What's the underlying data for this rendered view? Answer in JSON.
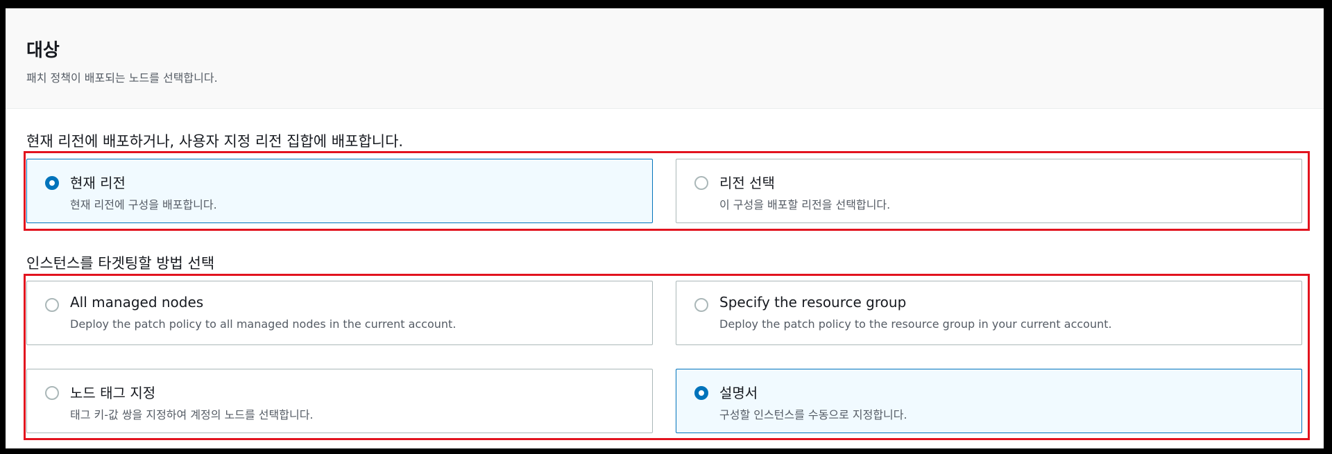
{
  "header": {
    "title": "대상",
    "description": "패치 정책이 배포되는 노드를 선택합니다."
  },
  "region_section": {
    "label": "현재 리전에 배포하거나, 사용자 지정 리전 집합에 배포합니다.",
    "options": [
      {
        "title": "현재 리전",
        "description": "현재 리전에 구성을 배포합니다.",
        "selected": true
      },
      {
        "title": "리전 선택",
        "description": "이 구성을 배포할 리전을 선택합니다.",
        "selected": false
      }
    ]
  },
  "target_section": {
    "label": "인스턴스를 타겟팅할 방법 선택",
    "options": [
      {
        "title": "All managed nodes",
        "description": "Deploy the patch policy to all managed nodes in the current account.",
        "selected": false
      },
      {
        "title": "Specify the resource group",
        "description": "Deploy the patch policy to the resource group in your current account.",
        "selected": false
      },
      {
        "title": "노드 태그 지정",
        "description": "태그 키-값 쌍을 지정하여 계정의 노드를 선택합니다.",
        "selected": false
      },
      {
        "title": "설명서",
        "description": "구성할 인스턴스를 수동으로 지정합니다.",
        "selected": true
      }
    ]
  },
  "colors": {
    "accent": "#0073bb",
    "highlight": "#e2131e",
    "selected_bg": "#f1faff"
  }
}
